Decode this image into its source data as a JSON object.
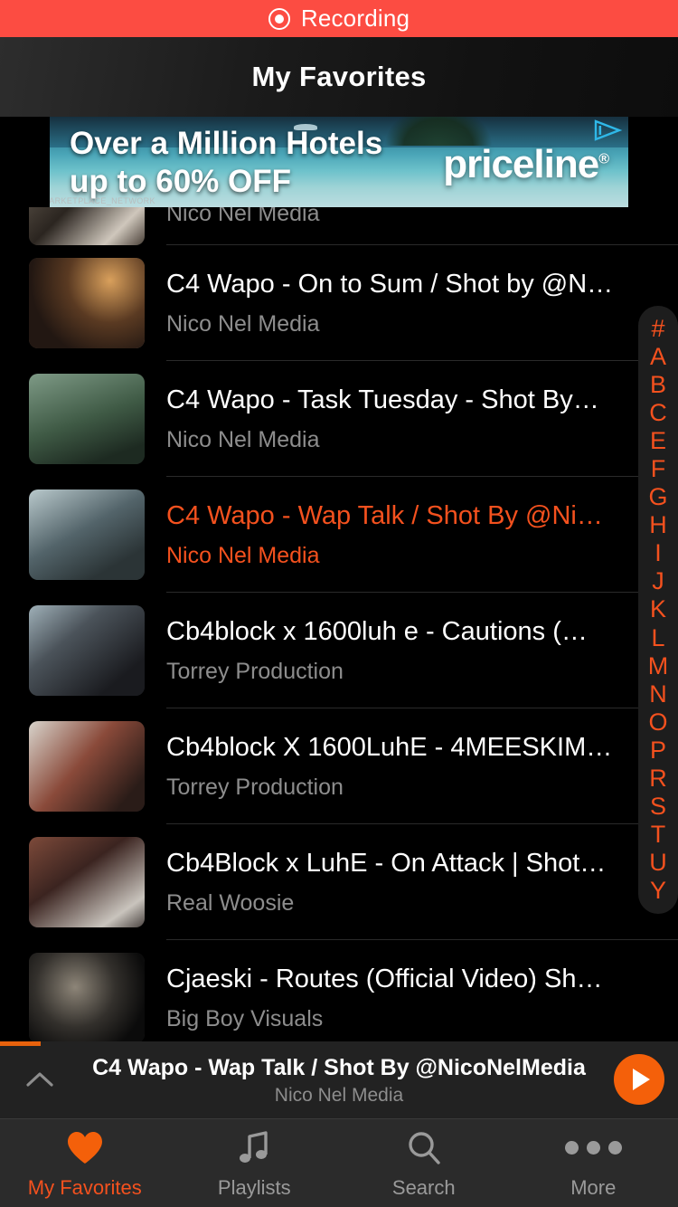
{
  "status": {
    "recording_label": "Recording",
    "recording_icon": "record-dot-icon",
    "bar_color": "#fc4c42"
  },
  "header": {
    "title": "My Favorites"
  },
  "ad": {
    "line1": "Over a Million Hotels",
    "line2": "up to 60% OFF",
    "brand": "priceline",
    "brand_mark": "®",
    "adchoices_icon": "adchoices-icon",
    "network_label": "AMAZON_MARKETPLACE_NETWORK"
  },
  "list": {
    "items": [
      {
        "title": "",
        "subtitle": "Nico Nel Media",
        "active": false,
        "partial": true
      },
      {
        "title": "C4 Wapo - On to Sum / Shot by @N…",
        "subtitle": "Nico Nel Media",
        "active": false,
        "partial": false
      },
      {
        "title": "C4 Wapo - Task Tuesday - Shot By…",
        "subtitle": "Nico Nel Media",
        "active": false,
        "partial": false
      },
      {
        "title": "C4 Wapo - Wap Talk / Shot By @Ni…",
        "subtitle": "Nico Nel Media",
        "active": true,
        "partial": false
      },
      {
        "title": "Cb4block x 1600luh e - Cautions (…",
        "subtitle": "Torrey Production",
        "active": false,
        "partial": false
      },
      {
        "title": "Cb4block X 1600LuhE - 4MEESKIM…",
        "subtitle": "Torrey Production",
        "active": false,
        "partial": false
      },
      {
        "title": "Cb4Block x LuhE - On Attack | Shot…",
        "subtitle": "Real Woosie",
        "active": false,
        "partial": false
      },
      {
        "title": "Cjaeski - Routes (Official Video) Sh…",
        "subtitle": "Big Boy Visuals",
        "active": false,
        "partial": false
      }
    ]
  },
  "index_bar": {
    "letters": [
      "#",
      "A",
      "B",
      "C",
      "E",
      "F",
      "G",
      "H",
      "I",
      "J",
      "K",
      "L",
      "M",
      "N",
      "O",
      "P",
      "R",
      "S",
      "T",
      "U",
      "Y"
    ],
    "color": "#f4511e"
  },
  "player": {
    "title": "C4 Wapo - Wap Talk / Shot By @NicoNelMedia",
    "subtitle": "Nico Nel Media",
    "expand_icon": "chevron-up-icon",
    "play_icon": "play-icon",
    "progress_percent": 6,
    "accent_color": "#f4600a"
  },
  "tabbar": {
    "tabs": [
      {
        "label": "My Favorites",
        "icon": "heart-icon",
        "active": true
      },
      {
        "label": "Playlists",
        "icon": "music-note-icon",
        "active": false
      },
      {
        "label": "Search",
        "icon": "search-icon",
        "active": false
      },
      {
        "label": "More",
        "icon": "ellipsis-icon",
        "active": false
      }
    ]
  }
}
